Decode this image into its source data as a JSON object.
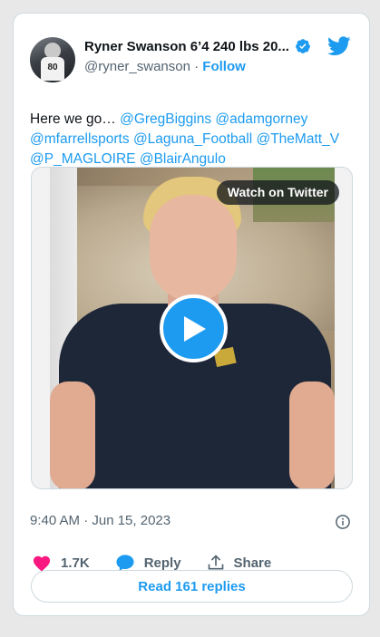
{
  "author": {
    "name": "Ryner Swanson 6’4 240 lbs 20...",
    "handle": "@ryner_swanson",
    "separator": "·",
    "follow_label": "Follow",
    "avatar_jersey_number": "80"
  },
  "tweet": {
    "lead_text": "Here we go… ",
    "mentions": [
      "@GregBiggins",
      "@adamgorney",
      "@mfarrellsports",
      "@Laguna_Football",
      "@TheMatt_V",
      "@P_MAGLOIRE",
      "@BlairAngulo"
    ]
  },
  "media": {
    "watch_label": "Watch on Twitter"
  },
  "timestamp": "9:40 AM · Jun 15, 2023",
  "actions": {
    "like_count": "1.7K",
    "reply_label": "Reply",
    "share_label": "Share"
  },
  "read_replies_label": "Read 161 replies",
  "colors": {
    "accent": "#1d9bf0",
    "like": "#f91880",
    "text_primary": "#0f1419",
    "text_secondary": "#536471",
    "border": "#cfd9de"
  },
  "icons": [
    "verified-badge-icon",
    "twitter-bird-icon",
    "play-icon",
    "info-icon",
    "heart-icon",
    "reply-bubble-icon",
    "share-icon"
  ]
}
